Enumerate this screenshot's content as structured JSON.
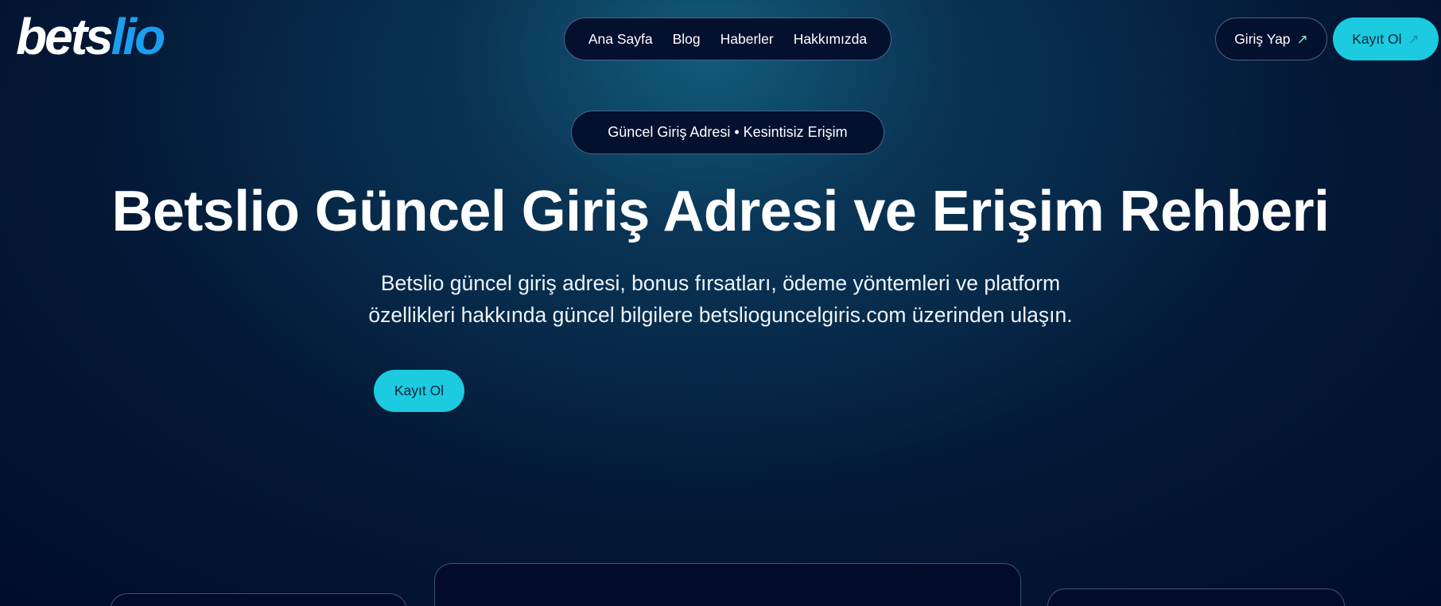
{
  "logo": {
    "text_part1": "bets",
    "text_part2": "lio",
    "color_primary": "#ffffff",
    "color_accent": "#1a9ff0"
  },
  "nav": {
    "items": [
      {
        "label": "Ana Sayfa"
      },
      {
        "label": "Blog"
      },
      {
        "label": "Haberler"
      },
      {
        "label": "Hakkımızda"
      }
    ]
  },
  "header": {
    "login_label": "Giriş Yap",
    "signup_label": "Kayıt Ol",
    "arrow_icon": "arrow-up-right-icon"
  },
  "hero": {
    "badge": "Güncel Giriş Adresi • Kesintisiz Erişim",
    "title": "Betslio Güncel Giriş Adresi ve Erişim Rehberi",
    "description_line1": "Betslio güncel giriş adresi, bonus fırsatları, ödeme yöntemleri ve platform",
    "description_line2": "özellikleri hakkında güncel bilgilere betslioguncelgiris.com üzerinden ulaşın.",
    "cta_label": "Kayıt Ol"
  },
  "colors": {
    "accent_cyan": "#1ccbe0",
    "background_dark": "#020d2a",
    "pill_background": "#03102e"
  }
}
